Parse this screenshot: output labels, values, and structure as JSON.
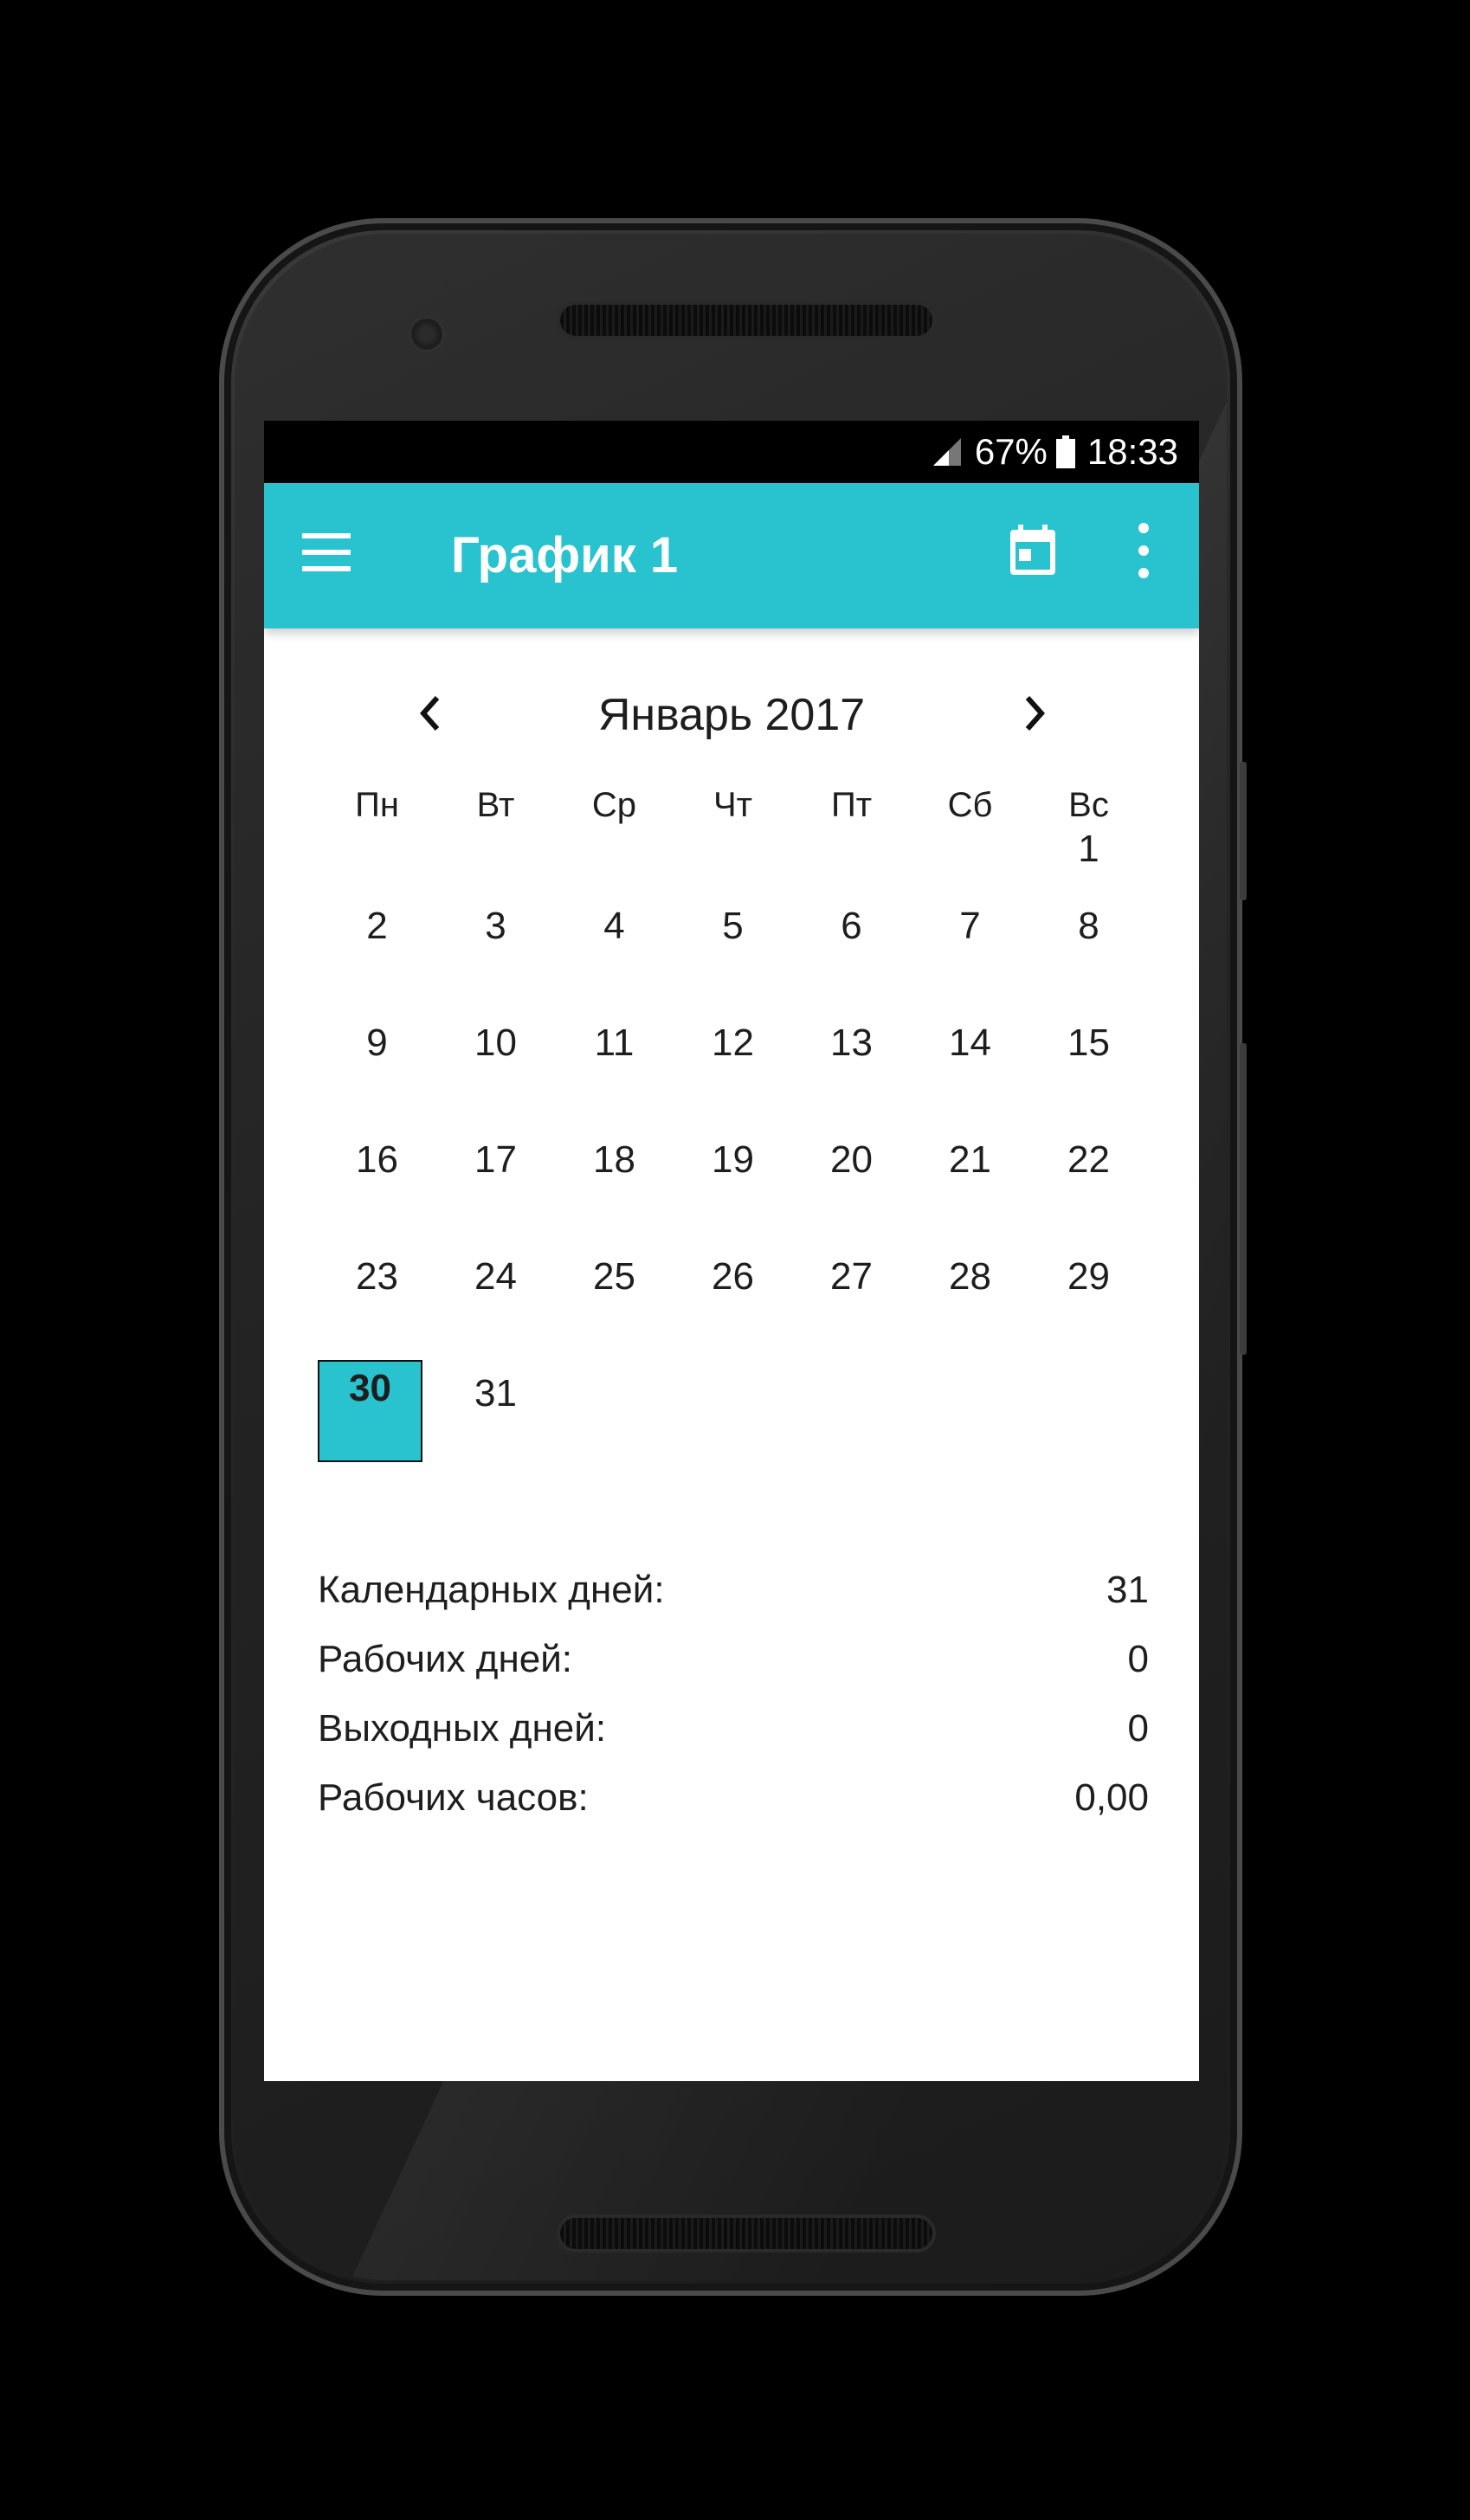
{
  "status_bar": {
    "battery": "67%",
    "time": "18:33"
  },
  "app_bar": {
    "title": "График 1",
    "icons": [
      "menu-icon",
      "calendar-icon",
      "more-vert-icon"
    ]
  },
  "calendar": {
    "month_title": "Январь 2017",
    "weekdays": [
      "Пн",
      "Вт",
      "Ср",
      "Чт",
      "Пт",
      "Сб",
      "Вс"
    ],
    "weeks": [
      [
        "",
        "",
        "",
        "",
        "",
        "",
        "1"
      ],
      [
        "2",
        "3",
        "4",
        "5",
        "6",
        "7",
        "8"
      ],
      [
        "9",
        "10",
        "11",
        "12",
        "13",
        "14",
        "15"
      ],
      [
        "16",
        "17",
        "18",
        "19",
        "20",
        "21",
        "22"
      ],
      [
        "23",
        "24",
        "25",
        "26",
        "27",
        "28",
        "29"
      ],
      [
        "30",
        "31",
        "",
        "",
        "",
        "",
        ""
      ]
    ],
    "selected_day": "30",
    "selected_color": "#29c2cf"
  },
  "stats": [
    {
      "label": "Календарных дней:",
      "value": "31"
    },
    {
      "label": "Рабочих дней:",
      "value": "0"
    },
    {
      "label": "Выходных дней:",
      "value": "0"
    },
    {
      "label": "Рабочих часов:",
      "value": "0,00"
    }
  ],
  "colors": {
    "accent": "#29c2cf",
    "background": "#000000"
  }
}
